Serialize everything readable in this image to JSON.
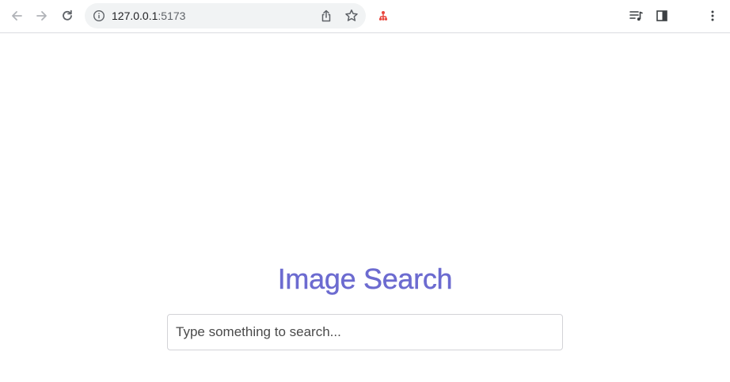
{
  "browser": {
    "url_host": "127.0.0.1",
    "url_port": ":5173",
    "icons": {
      "back": "arrow-left-icon",
      "forward": "arrow-right-icon",
      "reload": "reload-icon",
      "site_info": "info-icon",
      "share": "share-icon",
      "bookmark": "star-icon",
      "extension": "extension-icon",
      "media": "media-controls-icon",
      "side_panel": "side-panel-icon",
      "menu": "kebab-menu-icon"
    }
  },
  "page": {
    "title": "Image Search",
    "search": {
      "placeholder": "Type something to search...",
      "value": ""
    }
  },
  "colors": {
    "title": "#6c6bd0",
    "extension_icon": "#e8453c"
  }
}
